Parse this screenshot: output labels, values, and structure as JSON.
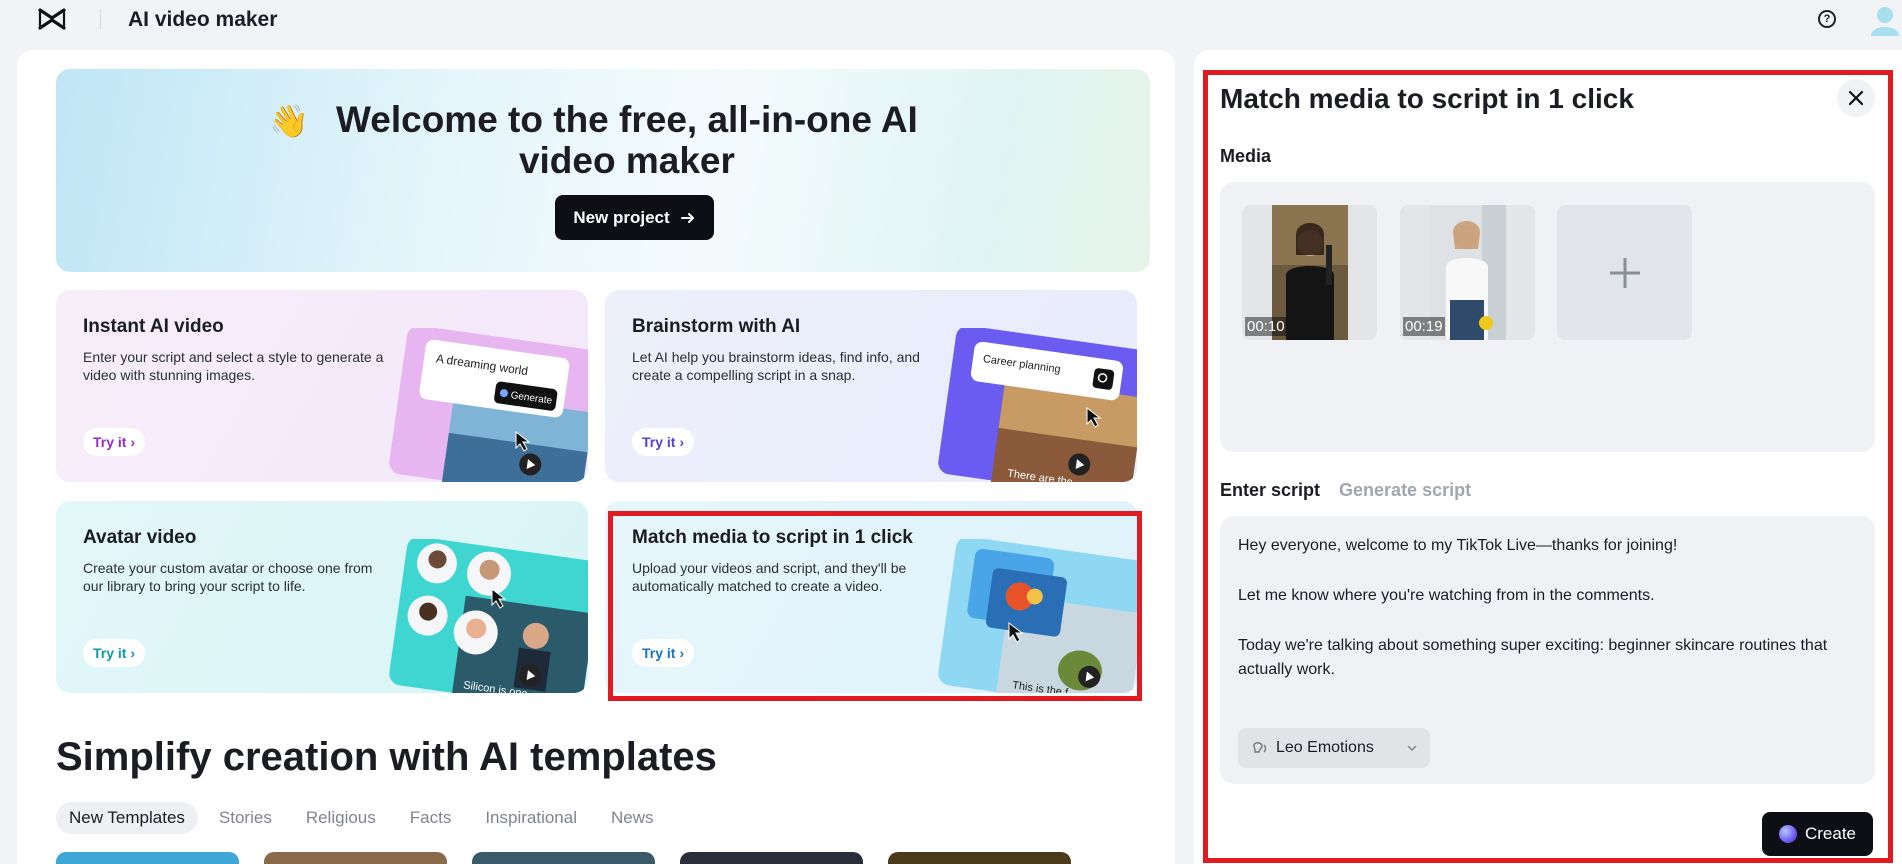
{
  "header": {
    "app_title": "AI video maker"
  },
  "hero": {
    "emoji": "👋",
    "title": "Welcome to the free, all-in-one AI video maker",
    "new_project_label": "New project"
  },
  "cards": [
    {
      "title": "Instant AI video",
      "desc": "Enter your script and select a style to generate a video with stunning images.",
      "try_label": "Try it",
      "art_text": "A dreaming world",
      "art_button": "Generate"
    },
    {
      "title": "Brainstorm with AI",
      "desc": "Let AI help you brainstorm ideas, find info, and create a compelling script in a snap.",
      "try_label": "Try it",
      "art_text": "Career planning",
      "art_caption": "There are the"
    },
    {
      "title": "Avatar video",
      "desc": "Create your custom avatar or choose one from our library to bring your script to life.",
      "try_label": "Try it",
      "art_caption": "Silicon is one"
    },
    {
      "title": "Match media to script in 1 click",
      "desc": "Upload your videos and script, and they'll be automatically matched to create a video.",
      "try_label": "Try it",
      "art_caption": "This is the f"
    }
  ],
  "templates": {
    "section_title": "Simplify creation with AI templates",
    "tabs": [
      "New Templates",
      "Stories",
      "Religious",
      "Facts",
      "Inspirational",
      "News"
    ],
    "active_tab": "New Templates"
  },
  "panel": {
    "title": "Match media to script in 1 click",
    "media_label": "Media",
    "media": [
      {
        "duration": "00:10"
      },
      {
        "duration": "00:19"
      }
    ],
    "script_tabs": [
      "Enter script",
      "Generate script"
    ],
    "script_lines": [
      "Hey everyone, welcome to my TikTok Live—thanks for joining!",
      "Let me know where you're watching from in the comments.",
      "Today we're talking about something super exciting: beginner skincare routines that actually work."
    ],
    "voice": "Leo Emotions",
    "create_label": "Create"
  },
  "colors": {
    "highlight": "#e11b22",
    "dark_button": "#0d0f14"
  }
}
